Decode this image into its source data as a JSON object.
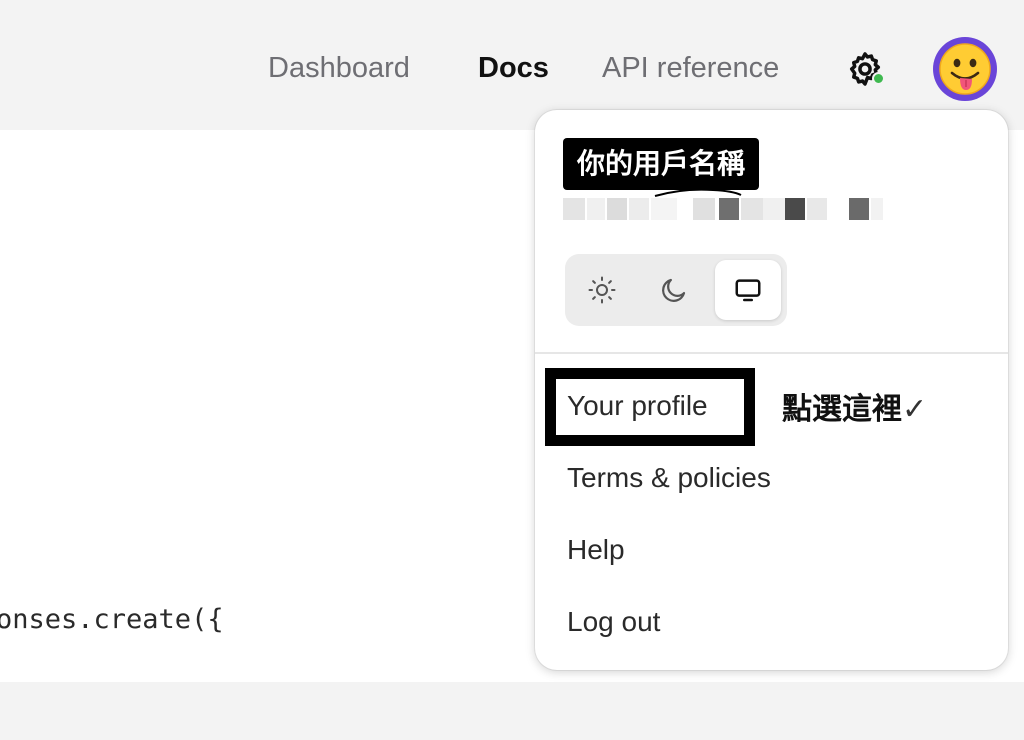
{
  "nav": {
    "links": [
      "Dashboard",
      "Docs",
      "API reference"
    ],
    "active": "Docs"
  },
  "icons": {
    "settings": "gear-icon",
    "avatar": "grinning-tongue-face-emoji",
    "status": "online-status-dot"
  },
  "colors": {
    "avatar_bg": "#6a45d8",
    "status_dot": "#3fb950",
    "annotation_box": "#000000"
  },
  "code": {
    "visible_line": "onses.create({"
  },
  "menu": {
    "username_label": "你的用戶名稱",
    "theme_options": [
      "light",
      "dark",
      "system"
    ],
    "theme_selected": "system",
    "items": [
      "Your profile",
      "Terms & policies",
      "Help",
      "Log out"
    ]
  },
  "annotation": {
    "text": "點選這裡",
    "mark": "✓"
  }
}
